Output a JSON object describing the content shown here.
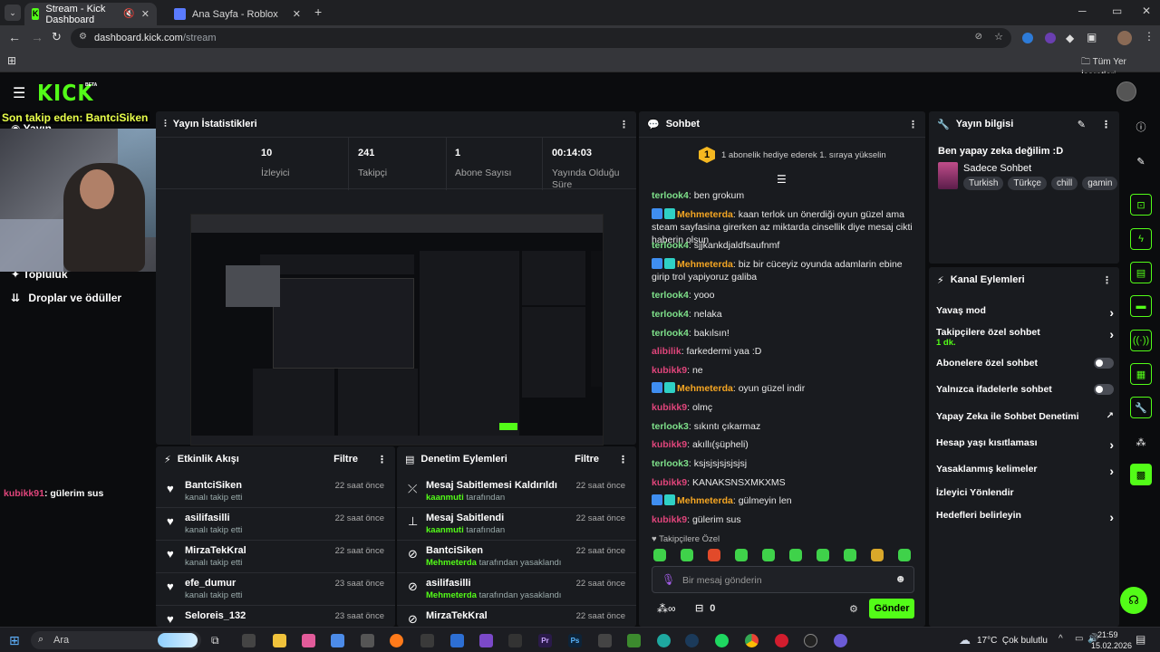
{
  "browser": {
    "tabs": [
      {
        "title": "Stream - Kick Dashboard",
        "active": true
      },
      {
        "title": "Ana Sayfa - Roblox",
        "active": false
      }
    ],
    "url_domain": "dashboard.kick.com",
    "url_path": "/stream",
    "bookmarks_label": "Tüm Yer İşaretleri"
  },
  "kick": {
    "logo": "KICK",
    "logo_badge": "BETA"
  },
  "overlay": {
    "follower_text": "Son takip eden: BantciSiken"
  },
  "sidebar": {
    "items": [
      {
        "label": "Yayın"
      },
      {
        "label": "Topluluk"
      },
      {
        "label": "Droplar ve ödüller"
      }
    ],
    "chat_user": "kubikk91",
    "chat_text": ": gülerim sus"
  },
  "stats": {
    "title": "Yayın İstatistikleri",
    "items": [
      {
        "value": "10",
        "label": "İzleyici"
      },
      {
        "value": "241",
        "label": "Takipçi"
      },
      {
        "value": "1",
        "label": "Abone Sayısı"
      },
      {
        "value": "00:14:03",
        "label": "Yayında Olduğu Süre"
      }
    ]
  },
  "activity": {
    "title": "Etkinlik Akışı",
    "filter": "Filtre",
    "rows": [
      {
        "name": "BantciSiken",
        "sub": "kanalı takip etti",
        "time": "22 saat önce"
      },
      {
        "name": "asilifasilli",
        "sub": "kanalı takip etti",
        "time": "22 saat önce"
      },
      {
        "name": "MirzaTekKral",
        "sub": "kanalı takip etti",
        "time": "22 saat önce"
      },
      {
        "name": "efe_dumur",
        "sub": "kanalı takip etti",
        "time": "23 saat önce"
      },
      {
        "name": "Seloreis_132",
        "sub": "",
        "time": "23 saat önce"
      }
    ]
  },
  "moderation": {
    "title": "Denetim Eylemleri",
    "filter": "Filtre",
    "rows": [
      {
        "name": "Mesaj Sabitlemesi Kaldırıldı",
        "by": "kaanmuti",
        "suffix": " tarafından",
        "time": "22 saat önce",
        "icon": "unpin-icon"
      },
      {
        "name": "Mesaj Sabitlendi",
        "by": "kaanmuti",
        "suffix": " tarafından",
        "time": "22 saat önce",
        "icon": "pin-icon"
      },
      {
        "name": "BantciSiken",
        "by": "Mehmeterda",
        "suffix": " tarafından yasaklandı",
        "time": "22 saat önce",
        "icon": "ban-icon"
      },
      {
        "name": "asilifasilli",
        "by": "Mehmeterda",
        "suffix": " tarafından yasaklandı",
        "time": "22 saat önce",
        "icon": "ban-icon"
      },
      {
        "name": "MirzaTekKral",
        "by": "",
        "suffix": "",
        "time": "22 saat önce",
        "icon": "ban-icon"
      }
    ]
  },
  "chat": {
    "title": "Sohbet",
    "banner_rank": "1",
    "banner_text": "1 abonelik hediye ederek 1. sıraya yükselin",
    "messages": [
      {
        "user": "terlook4",
        "color": "#7ee08a",
        "text": ": ben grokum",
        "badges": 0
      },
      {
        "user": "Mehmeterda",
        "color": "#f5a623",
        "text": ": kaan terlok un önerdiği oyun güzel ama steam sayfasina girerken az miktarda cinsellik diye mesaj cikti haberin olsun",
        "badges": 2
      },
      {
        "user": "terlook4",
        "color": "#7ee08a",
        "text": ": sjjkankdjaldfsaufnmf",
        "badges": 0
      },
      {
        "user": "Mehmeterda",
        "color": "#f5a623",
        "text": ": biz bir cüceyiz oyunda adamlarin ebine girip trol yapiyoruz galiba",
        "badges": 2
      },
      {
        "user": "terlook4",
        "color": "#7ee08a",
        "text": ": yooo",
        "badges": 0
      },
      {
        "user": "terlook4",
        "color": "#7ee08a",
        "text": ": nelaka",
        "badges": 0
      },
      {
        "user": "terlook4",
        "color": "#7ee08a",
        "text": ": bakılsın!",
        "badges": 0
      },
      {
        "user": "alibilik",
        "color": "#e0457b",
        "text": ": farkedermi yaa :D",
        "badges": 0
      },
      {
        "user": "kubikk9",
        "color": "#e0457b",
        "text": ": ne",
        "badges": 0
      },
      {
        "user": "Mehmeterda",
        "color": "#f5a623",
        "text": ": oyun güzel indir",
        "badges": 2
      },
      {
        "user": "kubikk9",
        "color": "#e0457b",
        "text": ": olmç",
        "badges": 0
      },
      {
        "user": "terlook3",
        "color": "#7ee08a",
        "text": ": sıkıntı çıkarmaz",
        "badges": 0
      },
      {
        "user": "kubikk9",
        "color": "#e0457b",
        "text": ": akıllı(şüpheli)",
        "badges": 0
      },
      {
        "user": "terlook3",
        "color": "#7ee08a",
        "text": ": ksjsjsjsjsjsjsj",
        "badges": 0
      },
      {
        "user": "kubikk9",
        "color": "#e0457b",
        "text": ": KANAKSNSXMKXMS",
        "badges": 0
      },
      {
        "user": "Mehmeterda",
        "color": "#f5a623",
        "text": ": gülmeyin len",
        "badges": 2
      },
      {
        "user": "kubikk9",
        "color": "#e0457b",
        "text": ": gülerim sus",
        "badges": 0
      }
    ],
    "followers_only_label": "Takipçilere Özel",
    "input_placeholder": "Bir mesaj gönderin",
    "points_value": "0",
    "send_label": "Gönder"
  },
  "stream_info": {
    "title": "Yayın bilgisi",
    "stream_title": "Ben yapay zeka değilim :D",
    "category": "Sadece Sohbet",
    "tags": [
      "Turkish",
      "Türkçe",
      "chill",
      "gamin"
    ]
  },
  "channel_actions": {
    "title": "Kanal Eylemleri",
    "rows": [
      {
        "label": "Yavaş mod",
        "control": "chevron"
      },
      {
        "label": "Takipçilere özel sohbet",
        "sub": "1 dk.",
        "control": "chevron"
      },
      {
        "label": "Abonelere özel sohbet",
        "control": "toggle"
      },
      {
        "label": "Yalnızca ifadelerle sohbet",
        "control": "toggle"
      },
      {
        "label": "Yapay Zeka ile Sohbet Denetimi",
        "control": "external"
      },
      {
        "label": "Hesap yaşı kısıtlaması",
        "control": "chevron"
      },
      {
        "label": "Yasaklanmış kelimeler",
        "control": "chevron"
      },
      {
        "label": "İzleyici Yönlendir",
        "control": "none"
      },
      {
        "label": "Hedefleri belirleyin",
        "control": "chevron"
      }
    ]
  },
  "taskbar": {
    "search_label": "Ara",
    "weather": "17°C  Çok bulutlu",
    "time": "21:59",
    "date": "15.02.2026"
  },
  "colors": {
    "kick_green": "#53fc18",
    "panel": "#191b1f",
    "background": "#0b0c0e"
  }
}
